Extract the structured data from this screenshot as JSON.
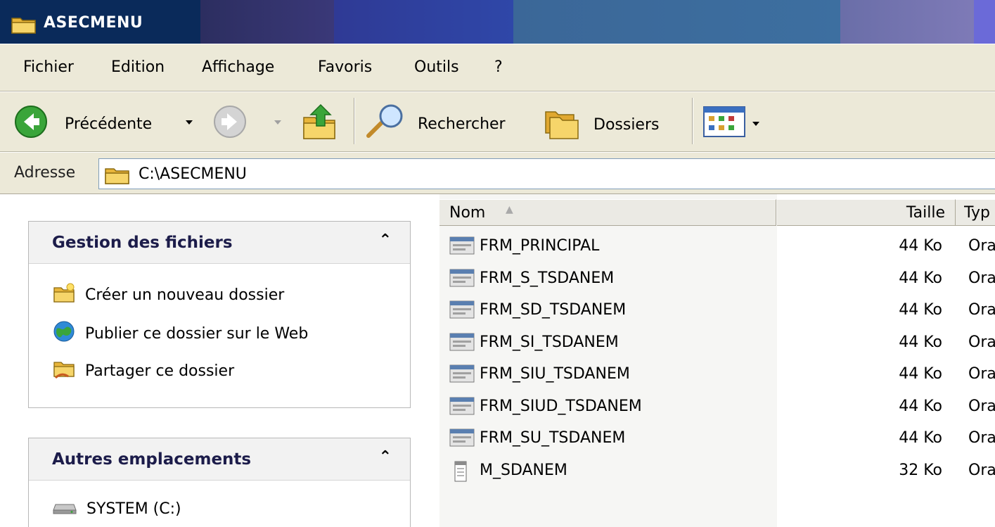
{
  "window": {
    "title": "ASECMENU"
  },
  "menu": [
    "Fichier",
    "Edition",
    "Affichage",
    "Favoris",
    "Outils",
    "?"
  ],
  "toolbar": {
    "back_label": "Précédente",
    "search_label": "Rechercher",
    "folders_label": "Dossiers"
  },
  "address": {
    "label": "Adresse",
    "value": "C:\\ASECMENU"
  },
  "tasks_panel": {
    "title": "Gestion des fichiers",
    "items": [
      "Créer un nouveau dossier",
      "Publier ce dossier sur le Web",
      "Partager ce dossier"
    ]
  },
  "places_panel": {
    "title": "Autres emplacements",
    "items": [
      "SYSTEM (C:)"
    ]
  },
  "file_list": {
    "columns": [
      "Nom",
      "Taille",
      "Typ"
    ],
    "rows": [
      {
        "name": "FRM_PRINCIPAL",
        "size": "44 Ko",
        "type": "Ora",
        "icon": "form-icon"
      },
      {
        "name": "FRM_S_TSDANEM",
        "size": "44 Ko",
        "type": "Ora",
        "icon": "form-icon"
      },
      {
        "name": "FRM_SD_TSDANEM",
        "size": "44 Ko",
        "type": "Ora",
        "icon": "form-icon"
      },
      {
        "name": "FRM_SI_TSDANEM",
        "size": "44 Ko",
        "type": "Ora",
        "icon": "form-icon"
      },
      {
        "name": "FRM_SIU_TSDANEM",
        "size": "44 Ko",
        "type": "Ora",
        "icon": "form-icon"
      },
      {
        "name": "FRM_SIUD_TSDANEM",
        "size": "44 Ko",
        "type": "Ora",
        "icon": "form-icon"
      },
      {
        "name": "FRM_SU_TSDANEM",
        "size": "44 Ko",
        "type": "Ora",
        "icon": "form-icon"
      },
      {
        "name": "M_SDANEM",
        "size": "32 Ko",
        "type": "Ora",
        "icon": "menu-file-icon"
      }
    ]
  }
}
